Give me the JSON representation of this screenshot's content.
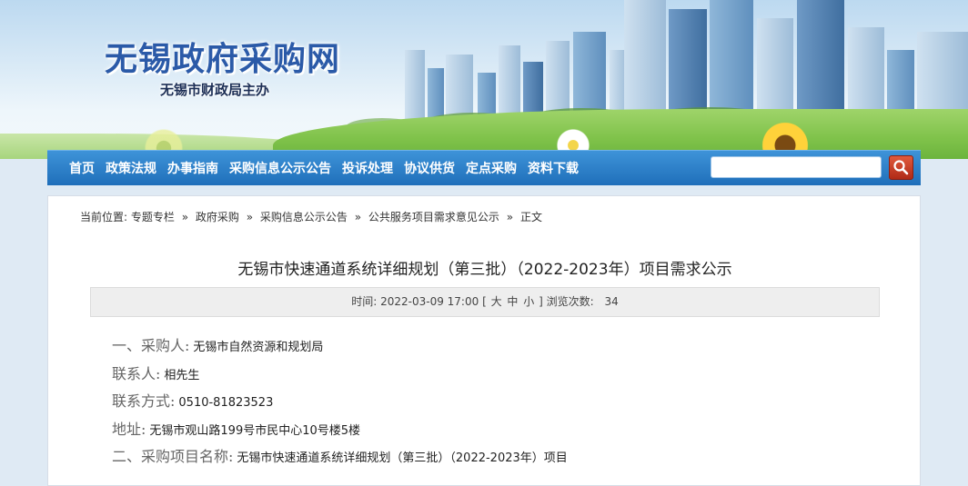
{
  "header": {
    "site_title": "无锡政府采购网",
    "site_subtitle": "无锡市财政局主办"
  },
  "nav": {
    "items": [
      "首页",
      "政策法规",
      "办事指南",
      "采购信息公示公告",
      "投诉处理",
      "协议供货",
      "定点采购",
      "资料下载"
    ],
    "search_placeholder": ""
  },
  "breadcrumb": {
    "prefix": "当前位置:",
    "items": [
      "专题专栏",
      "政府采购",
      "采购信息公示公告",
      "公共服务项目需求意见公示",
      "正文"
    ],
    "separator": "»"
  },
  "article": {
    "title": "无锡市快速通道系统详细规划（第三批）（2022-2023年）项目需求公示",
    "meta": {
      "time_label": "时间:",
      "time": "2022-03-09 17:00",
      "size_open": "[",
      "size_large": "大",
      "size_medium": "中",
      "size_small": "小",
      "size_close": "]",
      "views_label": "浏览次数:",
      "views": "34"
    },
    "lines": [
      {
        "label": "一、采购人:",
        "value": "无锡市自然资源和规划局"
      },
      {
        "label": "联系人:",
        "value": "相先生"
      },
      {
        "label": "联系方式:",
        "value": "0510-81823523"
      },
      {
        "label": "地址:",
        "value": "无锡市观山路199号市民中心10号楼5楼"
      },
      {
        "label": "二、采购项目名称:",
        "value": "无锡市快速通道系统详细规划（第三批）（2022-2023年）项目"
      }
    ]
  },
  "colors": {
    "nav_bg": "#2a7fc9",
    "title_blue": "#2b5aa8",
    "search_button": "#c23b22"
  },
  "icons": {
    "search_button": "magnifier-icon"
  }
}
